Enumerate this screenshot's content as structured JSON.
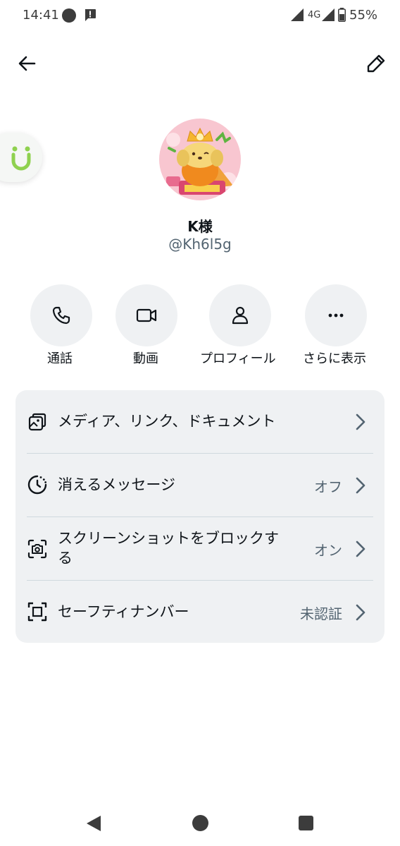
{
  "status_bar": {
    "time": "14:41",
    "network": "4G",
    "battery": "55%"
  },
  "header": {
    "back_icon": "arrow-left-icon",
    "edit_icon": "pencil-icon"
  },
  "profile": {
    "name": "K様",
    "handle": "@Kh6l5g"
  },
  "actions": [
    {
      "label": "通話",
      "icon": "phone-icon"
    },
    {
      "label": "動画",
      "icon": "video-camera-icon"
    },
    {
      "label": "プロフィール",
      "icon": "person-icon"
    },
    {
      "label": "さらに表示",
      "icon": "more-horizontal-icon"
    }
  ],
  "settings": [
    {
      "label": "メディア、リンク、ドキュメント",
      "value": "",
      "icon": "media-stack-icon"
    },
    {
      "label": "消えるメッセージ",
      "value": "オフ",
      "icon": "timer-icon"
    },
    {
      "label_line1": "スクリーンショットをブロックす",
      "label_line2": "る",
      "value": "オン",
      "icon": "screenshot-camera-icon"
    },
    {
      "label": "セーフティナンバー",
      "value": "未認証",
      "icon": "scan-frame-icon"
    }
  ],
  "colors": {
    "accent_green": "#8fd14f",
    "card_bg": "#eff1f3",
    "secondary_text": "#536471"
  }
}
